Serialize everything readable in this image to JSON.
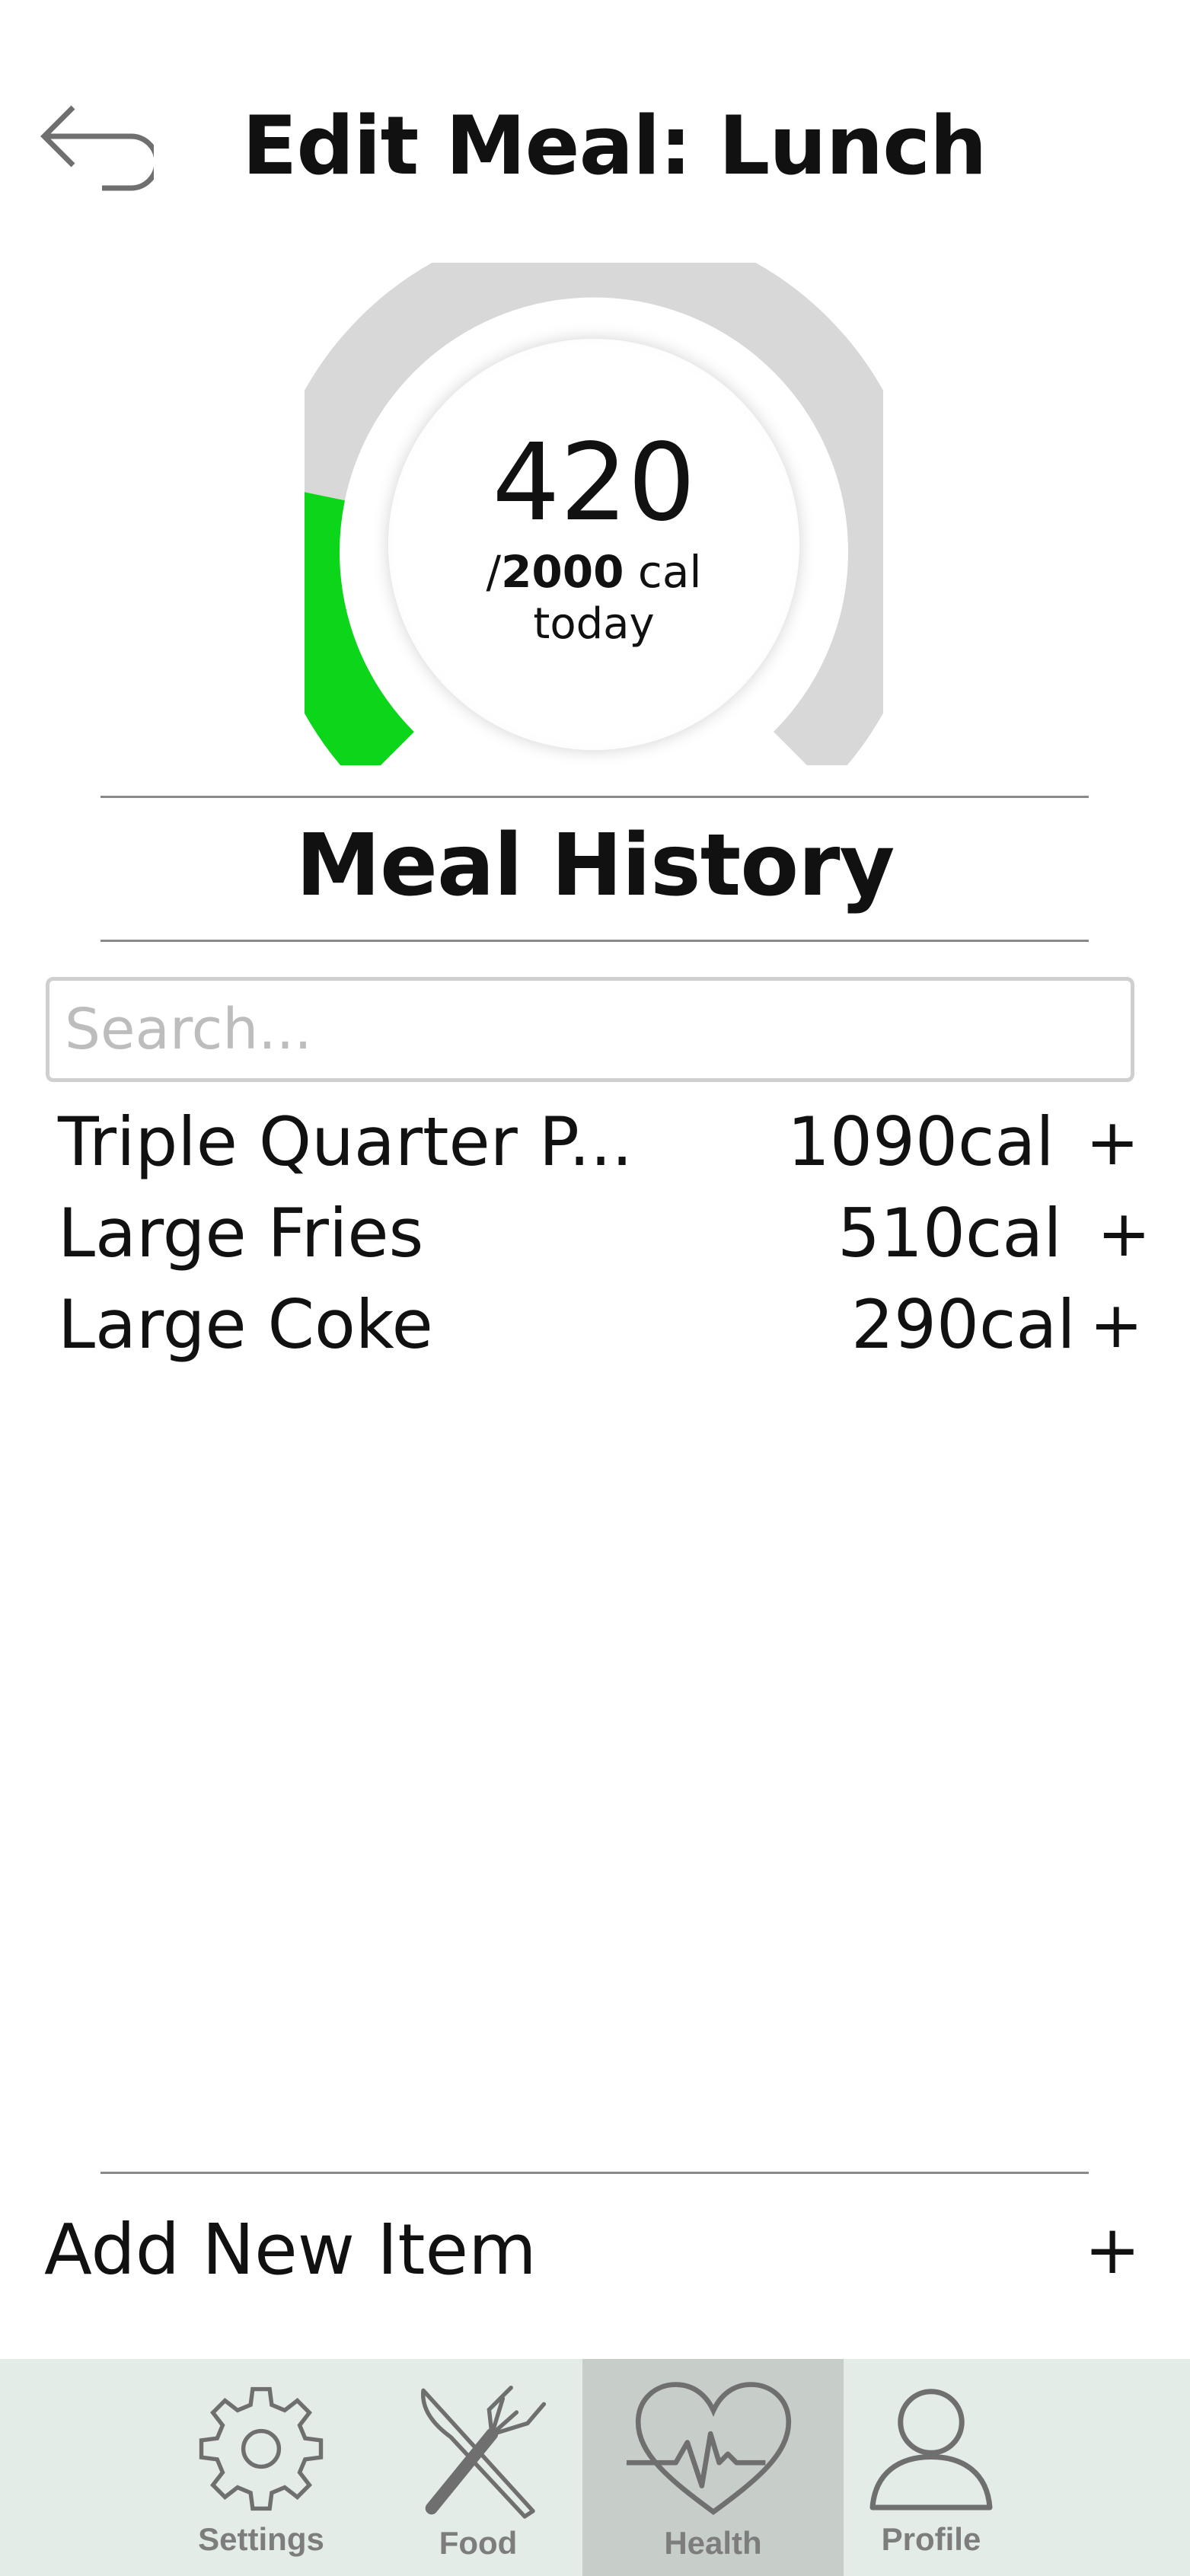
{
  "header": {
    "back_icon": "undo-arrow-icon",
    "title": "Edit Meal: Lunch"
  },
  "gauge": {
    "value": "420",
    "prefix": "/",
    "goal": "2000",
    "unit": " cal",
    "period": "today",
    "progress_fraction": 0.21,
    "fill_color": "#0bd61a",
    "track_color": "#d8d8d8"
  },
  "history": {
    "title": "Meal History",
    "search_placeholder": "Search...",
    "items": [
      {
        "name": "Triple Quarter P...",
        "calories": "1090cal",
        "add": "+"
      },
      {
        "name": "Large Fries",
        "calories": "510cal",
        "add": "+"
      },
      {
        "name": "Large Coke",
        "calories": "290cal",
        "add": "+"
      }
    ]
  },
  "add_item": {
    "label": "Add New Item",
    "plus": "+"
  },
  "nav": {
    "active": "Health",
    "tabs": [
      {
        "label": "Settings",
        "icon": "gear-icon"
      },
      {
        "label": "Food",
        "icon": "fork-knife-icon"
      },
      {
        "label": "Health",
        "icon": "heartbeat-icon"
      },
      {
        "label": "Profile",
        "icon": "user-icon"
      }
    ]
  }
}
